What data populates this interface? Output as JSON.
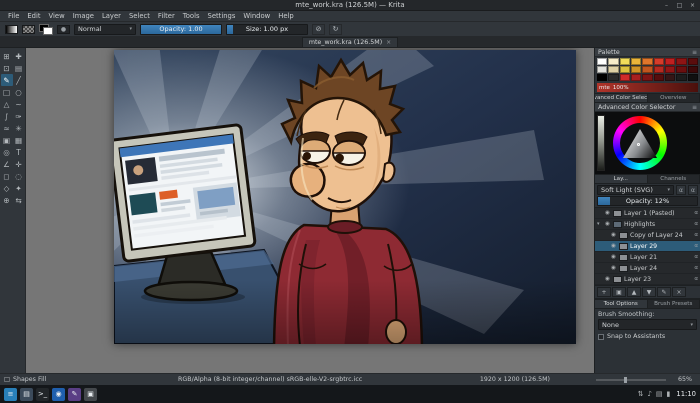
{
  "window": {
    "title": "mte_work.kra (126.5M) — Krita"
  },
  "menubar": {
    "items": [
      "File",
      "Edit",
      "View",
      "Image",
      "Layer",
      "Select",
      "Filter",
      "Tools",
      "Settings",
      "Window",
      "Help"
    ]
  },
  "toolbar": {
    "blend_mode": "Normal",
    "opacity": {
      "label": "Opacity:",
      "value": "1.00",
      "percent": 100
    },
    "size": {
      "label": "Size:",
      "value": "1.00 px",
      "percent": 8
    },
    "eraser_glyph": "⊘",
    "reload_glyph": "↻"
  },
  "tabbar": {
    "active_tab": "mte_work.kra (126.5M)"
  },
  "toolbox": {
    "tools": [
      {
        "name": "transform-tool",
        "glyph": "⊞",
        "active": false
      },
      {
        "name": "move-tool",
        "glyph": "✚",
        "active": false
      },
      {
        "name": "crop-tool",
        "glyph": "⊡",
        "active": false
      },
      {
        "name": "gradient-tool",
        "glyph": "▤",
        "active": false
      },
      {
        "name": "freehand-brush-tool",
        "glyph": "✎",
        "active": true
      },
      {
        "name": "line-tool",
        "glyph": "╱",
        "active": false
      },
      {
        "name": "rectangle-tool",
        "glyph": "□",
        "active": false
      },
      {
        "name": "ellipse-tool",
        "glyph": "○",
        "active": false
      },
      {
        "name": "polygon-tool",
        "glyph": "△",
        "active": false
      },
      {
        "name": "polyline-tool",
        "glyph": "~",
        "active": false
      },
      {
        "name": "bezier-curve-tool",
        "glyph": "∫",
        "active": false
      },
      {
        "name": "calligraphy-tool",
        "glyph": "✑",
        "active": false
      },
      {
        "name": "dynamic-brush-tool",
        "glyph": "≈",
        "active": false
      },
      {
        "name": "multibrush-tool",
        "glyph": "✳",
        "active": false
      },
      {
        "name": "fill-tool",
        "glyph": "▣",
        "active": false
      },
      {
        "name": "pattern-edit-tool",
        "glyph": "▦",
        "active": false
      },
      {
        "name": "color-sampler-tool",
        "glyph": "◎",
        "active": false
      },
      {
        "name": "text-tool",
        "glyph": "T",
        "active": false
      },
      {
        "name": "measure-tool",
        "glyph": "∠",
        "active": false
      },
      {
        "name": "assistants-tool",
        "glyph": "✛",
        "active": false
      },
      {
        "name": "rectangular-select-tool",
        "glyph": "◻",
        "active": false
      },
      {
        "name": "elliptical-select-tool",
        "glyph": "◌",
        "active": false
      },
      {
        "name": "polygonal-select-tool",
        "glyph": "◇",
        "active": false
      },
      {
        "name": "similar-select-tool",
        "glyph": "✦",
        "active": false
      },
      {
        "name": "zoom-tool",
        "glyph": "⊕",
        "active": false
      },
      {
        "name": "pan-tool",
        "glyph": "⇆",
        "active": false
      }
    ]
  },
  "docker": {
    "palette": {
      "title": "Palette",
      "name": "mte",
      "scale": "100%",
      "swatches": [
        "#ffffff",
        "#f6ecc9",
        "#f2dd5a",
        "#eab53a",
        "#e0762b",
        "#d63c2a",
        "#c02020",
        "#8e1414",
        "#5a0d0d",
        "#e3e3de",
        "#ded0a4",
        "#dcc23f",
        "#cf9427",
        "#c1561f",
        "#b62a20",
        "#931616",
        "#6b0f0f",
        "#3d0909",
        "#000000",
        "#2a2a2a",
        "#d12a2a",
        "#a81f1f",
        "#7e1414",
        "#560d0d",
        "#341616",
        "#1d1d1d",
        "#101010"
      ]
    },
    "selector_tabs": {
      "advanced": "Advanced Color Selector",
      "overview": "Overview"
    },
    "advanced_selector": {
      "title": "Advanced Color Selector"
    },
    "layer_tabs": {
      "layers": "Lay...",
      "channels": "Channels"
    },
    "layers": {
      "blend_mode": "Soft Light (SVG)",
      "opacity_label": "Opacity:",
      "opacity_value": "12%",
      "opacity_percent": 12,
      "rows": [
        {
          "name": "Layer 1 (Pasted)",
          "indent": 0,
          "group": false,
          "selected": false
        },
        {
          "name": "Highlights",
          "indent": 0,
          "group": true,
          "selected": false
        },
        {
          "name": "Copy of Layer 24",
          "indent": 1,
          "group": false,
          "selected": false
        },
        {
          "name": "Layer 29",
          "indent": 1,
          "group": false,
          "selected": true
        },
        {
          "name": "Layer 21",
          "indent": 1,
          "group": false,
          "selected": false
        },
        {
          "name": "Layer 24",
          "indent": 1,
          "group": false,
          "selected": false
        },
        {
          "name": "Layer 23",
          "indent": 0,
          "group": false,
          "selected": false
        }
      ],
      "buttons": [
        {
          "name": "add-layer-button",
          "glyph": "+"
        },
        {
          "name": "duplicate-layer-button",
          "glyph": "▣"
        },
        {
          "name": "move-layer-up-button",
          "glyph": "▲"
        },
        {
          "name": "move-layer-down-button",
          "glyph": "▼"
        },
        {
          "name": "layer-properties-button",
          "glyph": "✎"
        },
        {
          "name": "delete-layer-button",
          "glyph": "×"
        }
      ]
    },
    "tool_tabs": {
      "tool_options": "Tool Options",
      "brush_presets": "Brush Presets"
    },
    "tool_options": {
      "smoothing_label": "Brush Smoothing:",
      "smoothing_value": "None"
    },
    "snap_label": "Snap to Assistants"
  },
  "statusbar": {
    "tool_hint": "Shapes Fill",
    "color_profile": "RGB/Alpha (8-bit integer/channel)  sRGB-elle-V2-srgbtrc.icc",
    "canvas_size": "1920 x 1200 (126.5M)",
    "zoom": "65%"
  },
  "taskbar": {
    "apps": [
      {
        "name": "application-menu",
        "glyph": "≡",
        "color": "#2980b9"
      },
      {
        "name": "file-manager",
        "glyph": "▤",
        "color": "#3b4a5a"
      },
      {
        "name": "terminal",
        "glyph": ">_",
        "color": "#222629"
      },
      {
        "name": "web-browser",
        "glyph": "◉",
        "color": "#1f5fae"
      },
      {
        "name": "krita-app",
        "glyph": "✎",
        "color": "#5a3e85"
      },
      {
        "name": "image-viewer",
        "glyph": "▣",
        "color": "#44484c"
      }
    ],
    "tray": [
      {
        "name": "network-tray-icon",
        "glyph": "⇅"
      },
      {
        "name": "volume-tray-icon",
        "glyph": "♪"
      },
      {
        "name": "clipboard-tray-icon",
        "glyph": "▤"
      },
      {
        "name": "battery-tray-icon",
        "glyph": "▮"
      }
    ],
    "clock": "11:10"
  },
  "icons": {
    "dropdown_arrow": "▾",
    "close": "×",
    "minimize": "–",
    "maximize": "□",
    "menu": "≡",
    "alpha": "α",
    "eye": "◉",
    "expander": "▾",
    "dot": "●",
    "square": "□"
  },
  "colors": {
    "accent": "#3daee9",
    "panel": "#31363b",
    "panel_dark": "#232629",
    "canvas_bg": "#767676",
    "selection": "#2d5c79"
  }
}
